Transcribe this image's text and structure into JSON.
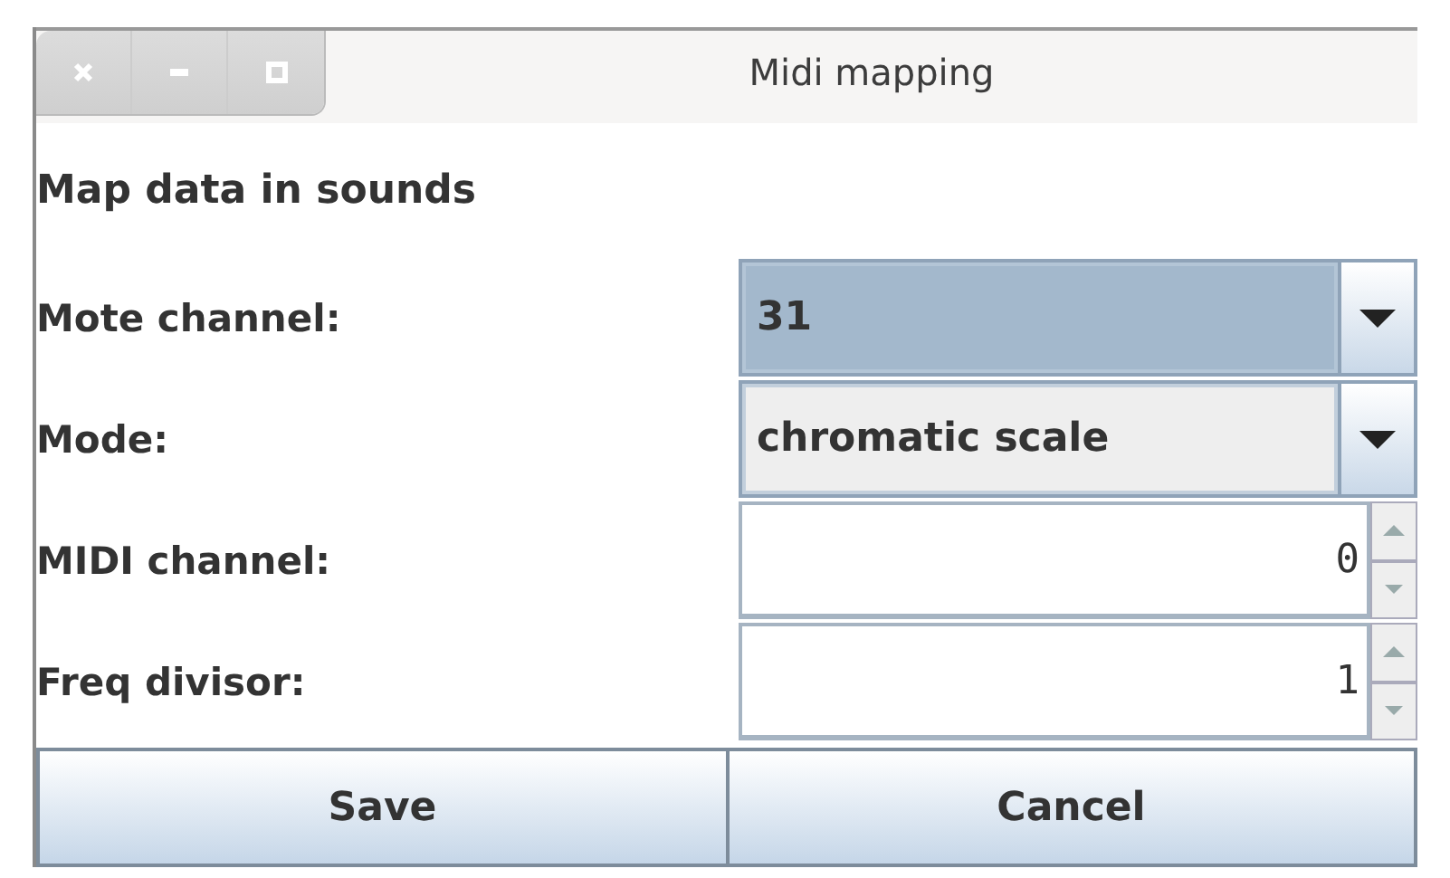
{
  "window": {
    "title": "Midi mapping"
  },
  "heading": "Map data in sounds",
  "fields": [
    {
      "label": "Mote channel:",
      "kind": "combo",
      "value": "31",
      "focused": true
    },
    {
      "label": "Mode:",
      "kind": "combo",
      "value": "chromatic scale",
      "focused": false
    },
    {
      "label": "MIDI channel:",
      "kind": "spinner",
      "value": "0"
    },
    {
      "label": "Freq divisor:",
      "kind": "spinner",
      "value": "1"
    }
  ],
  "buttons": [
    "Save",
    "Cancel"
  ]
}
